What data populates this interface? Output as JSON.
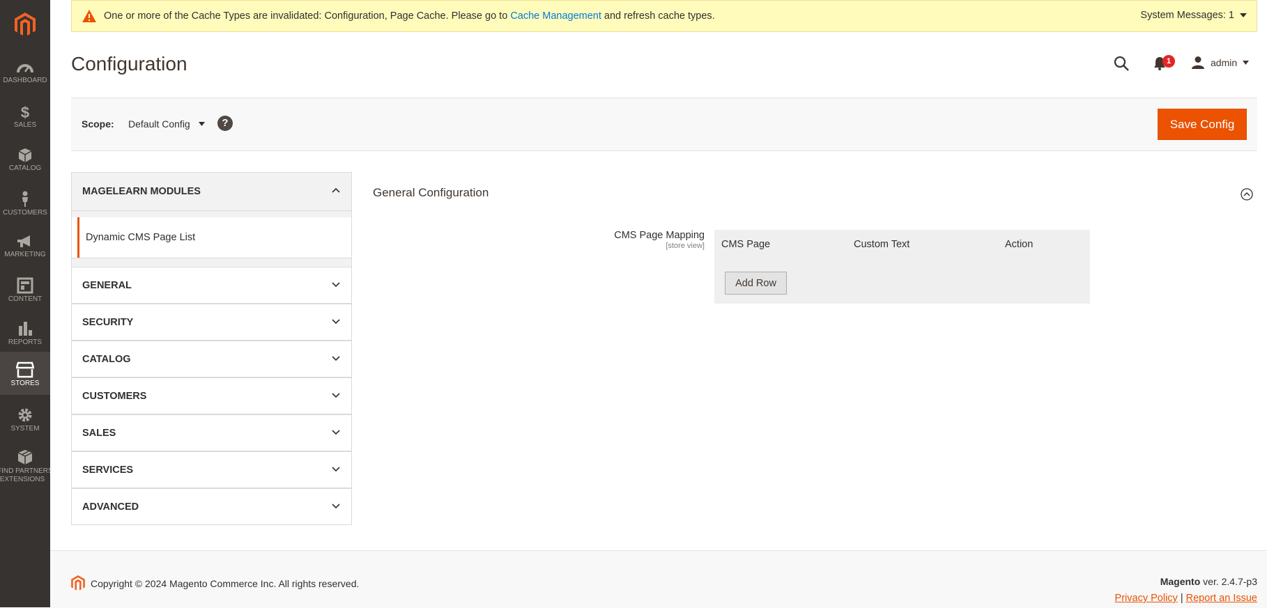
{
  "sidebar": {
    "items": [
      {
        "label": "DASHBOARD",
        "icon": "dashboard-icon"
      },
      {
        "label": "SALES",
        "icon": "dollar-icon"
      },
      {
        "label": "CATALOG",
        "icon": "box-icon"
      },
      {
        "label": "CUSTOMERS",
        "icon": "person-icon"
      },
      {
        "label": "MARKETING",
        "icon": "megaphone-icon"
      },
      {
        "label": "CONTENT",
        "icon": "layout-icon"
      },
      {
        "label": "REPORTS",
        "icon": "bar-chart-icon"
      },
      {
        "label": "STORES",
        "icon": "storefront-icon"
      },
      {
        "label": "SYSTEM",
        "icon": "gear-icon"
      },
      {
        "label_line1": "FIND PARTNERS &",
        "label_line2": "EXTENSIONS",
        "icon": "cubes-icon"
      }
    ]
  },
  "system_message": {
    "text_before": "One or more of the Cache Types are invalidated: Configuration, Page Cache. Please go to ",
    "link": "Cache Management",
    "text_after": " and refresh cache types.",
    "count_label": "System Messages: 1"
  },
  "header": {
    "title": "Configuration",
    "notifications_count": "1",
    "user": "admin"
  },
  "scope": {
    "label": "Scope:",
    "value": "Default Config",
    "help": "?",
    "save_label": "Save Config"
  },
  "tabs": {
    "open_group": "MAGELEARN MODULES",
    "open_item": "Dynamic CMS Page List",
    "groups": [
      "GENERAL",
      "SECURITY",
      "CATALOG",
      "CUSTOMERS",
      "SALES",
      "SERVICES",
      "ADVANCED"
    ]
  },
  "section": {
    "title": "General Configuration",
    "field_label": "CMS Page Mapping",
    "field_scope": "[store view]",
    "columns": [
      "CMS Page",
      "Custom Text",
      "Action"
    ],
    "add_row_label": "Add Row"
  },
  "footer": {
    "copyright": "Copyright © 2024 Magento Commerce Inc. All rights reserved.",
    "brand": "Magento",
    "version": " ver. 2.4.7-p3",
    "privacy": "Privacy Policy",
    "separator": " | ",
    "report": "Report an Issue"
  },
  "colors": {
    "accent": "#eb5202",
    "sidebar_bg": "#373330",
    "message_bg": "#fffbbb",
    "link": "#007bdb"
  }
}
